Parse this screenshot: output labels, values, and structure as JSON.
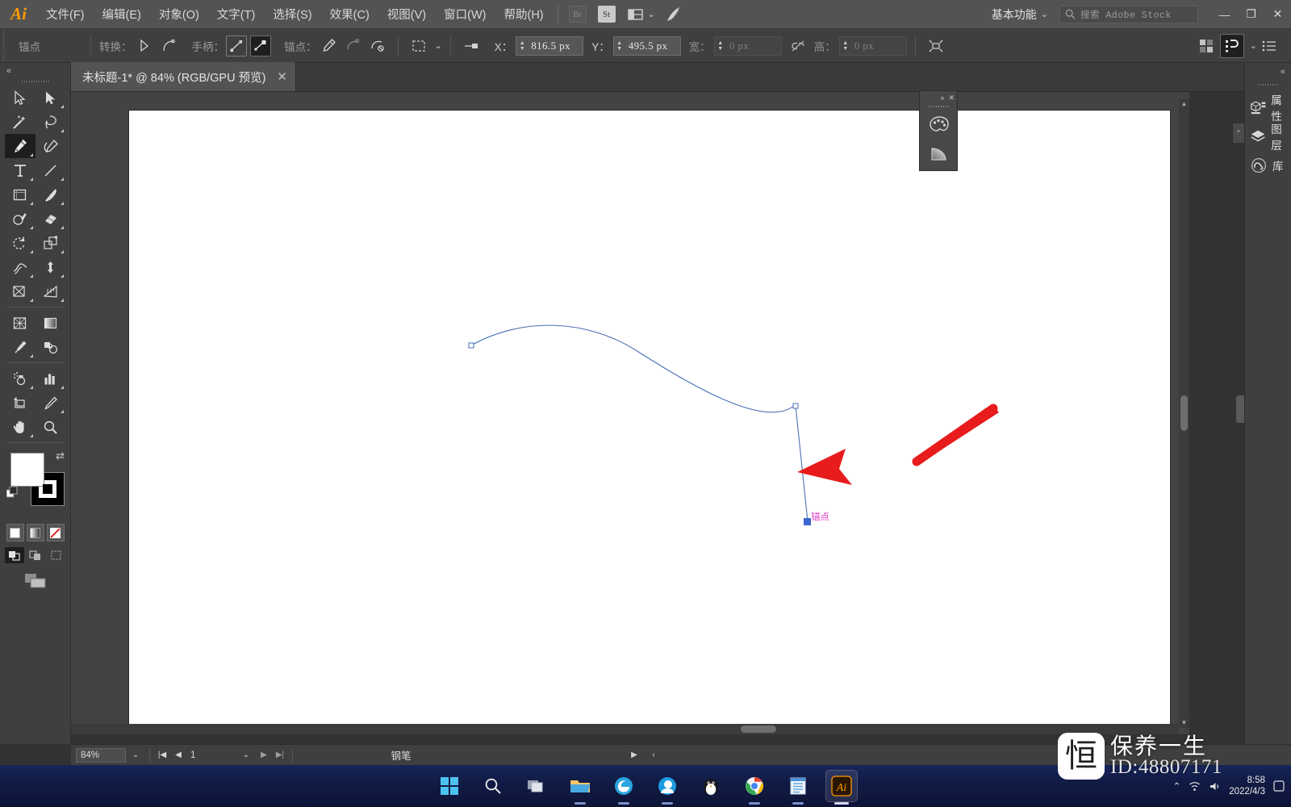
{
  "app": {
    "name": "Adobe Illustrator",
    "logo": "Ai"
  },
  "menubar": {
    "items": [
      {
        "label": "文件(F)",
        "name": "menu-file"
      },
      {
        "label": "编辑(E)",
        "name": "menu-edit"
      },
      {
        "label": "对象(O)",
        "name": "menu-object"
      },
      {
        "label": "文字(T)",
        "name": "menu-type"
      },
      {
        "label": "选择(S)",
        "name": "menu-select"
      },
      {
        "label": "效果(C)",
        "name": "menu-effect"
      },
      {
        "label": "视图(V)",
        "name": "menu-view"
      },
      {
        "label": "窗口(W)",
        "name": "menu-window"
      },
      {
        "label": "帮助(H)",
        "name": "menu-help"
      }
    ],
    "bridge_label": "Br",
    "stock_label": "St",
    "workspace": "基本功能",
    "search_placeholder": "搜索 Adobe Stock",
    "window_minimize": "—",
    "window_restore": "❐",
    "window_close": "✕"
  },
  "controlbar": {
    "context_label": "锚点",
    "convert_label": "转换：",
    "handles_label": "手柄：",
    "anchors_label": "锚点：",
    "x_label": "X：",
    "x_value": "816.5 px",
    "y_label": "Y：",
    "y_value": "495.5 px",
    "w_label": "宽：",
    "w_value": "0 px",
    "h_label": "高：",
    "h_value": "0 px"
  },
  "tabbar": {
    "document_title": "未标题-1* @ 84% (RGB/GPU 预览)",
    "close": "✕",
    "collapse": "«"
  },
  "toolbar": {
    "collapse": "«",
    "tools": [
      {
        "name": "selection-tool",
        "label": "选择工具",
        "selected": false
      },
      {
        "name": "direct-selection-tool",
        "label": "直接选择工具",
        "selected": false
      },
      {
        "name": "magic-wand-tool",
        "label": "魔棒工具",
        "selected": false
      },
      {
        "name": "lasso-tool",
        "label": "套索工具",
        "selected": false
      },
      {
        "name": "pen-tool",
        "label": "钢笔工具",
        "selected": true
      },
      {
        "name": "curvature-tool",
        "label": "曲率工具",
        "selected": false
      },
      {
        "name": "type-tool",
        "label": "文字工具",
        "selected": false
      },
      {
        "name": "line-segment-tool",
        "label": "直线段工具",
        "selected": false
      },
      {
        "name": "rectangle-tool",
        "label": "矩形工具",
        "selected": false
      },
      {
        "name": "paintbrush-tool",
        "label": "画笔工具",
        "selected": false
      },
      {
        "name": "shaper-tool",
        "label": "Shaper 工具",
        "selected": false
      },
      {
        "name": "eraser-tool",
        "label": "橡皮擦工具",
        "selected": false
      },
      {
        "name": "rotate-tool",
        "label": "旋转工具",
        "selected": false
      },
      {
        "name": "scale-tool",
        "label": "比例缩放工具",
        "selected": false
      },
      {
        "name": "width-tool",
        "label": "宽度工具",
        "selected": false
      },
      {
        "name": "free-transform-tool",
        "label": "自由变换工具",
        "selected": false
      },
      {
        "name": "shape-builder-tool",
        "label": "形状生成器工具",
        "selected": false
      },
      {
        "name": "perspective-grid-tool",
        "label": "透视网格工具",
        "selected": false
      },
      {
        "name": "mesh-tool",
        "label": "网格工具",
        "selected": false
      },
      {
        "name": "gradient-tool",
        "label": "渐变工具",
        "selected": false
      },
      {
        "name": "eyedropper-tool",
        "label": "吸管工具",
        "selected": false
      },
      {
        "name": "blend-tool",
        "label": "混合工具",
        "selected": false
      },
      {
        "name": "symbol-sprayer-tool",
        "label": "符号喷枪工具",
        "selected": false
      },
      {
        "name": "column-graph-tool",
        "label": "柱形图工具",
        "selected": false
      },
      {
        "name": "artboard-tool",
        "label": "画板工具",
        "selected": false
      },
      {
        "name": "slice-tool",
        "label": "切片工具",
        "selected": false
      },
      {
        "name": "hand-tool",
        "label": "抓手工具",
        "selected": false
      },
      {
        "name": "zoom-tool",
        "label": "缩放工具",
        "selected": false
      }
    ],
    "fill_color": "#ffffff",
    "stroke_color": "#000000",
    "swap_icon": "⇄",
    "swatch_modes": [
      {
        "name": "color-swatch-button",
        "label": "颜色"
      },
      {
        "name": "gradient-swatch-button",
        "label": "渐变"
      },
      {
        "name": "none-swatch-button",
        "label": "无"
      }
    ],
    "draw_modes": [
      {
        "name": "draw-normal-button",
        "label": "正常绘图",
        "selected": true
      },
      {
        "name": "draw-behind-button",
        "label": "背面绘图",
        "selected": false
      },
      {
        "name": "draw-inside-button",
        "label": "内部绘图",
        "selected": false
      }
    ]
  },
  "canvas": {
    "anchor_tooltip": "锚点",
    "tooltip_color": "#e040c8",
    "path_color": "#4a6fb5",
    "selected_anchor_color": "#3a66d0",
    "arrow_color": "#e81c1c",
    "artboard_color": "#ffffff"
  },
  "floatpanel": {
    "expand": "»",
    "close": "✕",
    "buttons": [
      {
        "name": "color-panel-button",
        "label": "颜色"
      },
      {
        "name": "gradient-panel-button",
        "label": "渐变"
      }
    ]
  },
  "rightdock": {
    "collapse": "«",
    "items": [
      {
        "label": "属性",
        "name": "panel-properties",
        "icon": "properties-icon"
      },
      {
        "label": "图层",
        "name": "panel-layers",
        "icon": "layers-icon"
      },
      {
        "label": "库",
        "name": "panel-libraries",
        "icon": "libraries-icon"
      }
    ]
  },
  "statusbar": {
    "zoom": "84%",
    "zoom_dropdown": "⌄",
    "page_first": "|◀",
    "page_prev": "◀",
    "page_value": "1",
    "page_dropdown": "⌄",
    "page_next": "▶",
    "page_last": "▶|",
    "current_tool": "钢笔",
    "play": "▶",
    "collapse": "‹"
  },
  "taskbar": {
    "apps": [
      {
        "name": "start-button",
        "label": "开始",
        "active": false,
        "running": false
      },
      {
        "name": "search-button",
        "label": "搜索",
        "active": false,
        "running": false
      },
      {
        "name": "task-view-button",
        "label": "任务视图",
        "active": false,
        "running": false
      },
      {
        "name": "file-explorer-button",
        "label": "文件资源管理器",
        "active": false,
        "running": true
      },
      {
        "name": "edge-button",
        "label": "Microsoft Edge",
        "active": false,
        "running": true
      },
      {
        "name": "browser-button",
        "label": "浏览器",
        "active": false,
        "running": true
      },
      {
        "name": "qq-button",
        "label": "QQ",
        "active": false,
        "running": false
      },
      {
        "name": "chrome-button",
        "label": "Google Chrome",
        "active": false,
        "running": true
      },
      {
        "name": "notepad-button",
        "label": "记事本",
        "active": false,
        "running": true
      },
      {
        "name": "illustrator-button",
        "label": "Adobe Illustrator",
        "active": true,
        "running": true
      }
    ],
    "tray_expand": "⌃",
    "clock_time": "8:58",
    "clock_date": "2022/4/3"
  },
  "watermark": {
    "logo_glyph": "恒",
    "title": "保养一生",
    "id": "ID:48807171"
  }
}
